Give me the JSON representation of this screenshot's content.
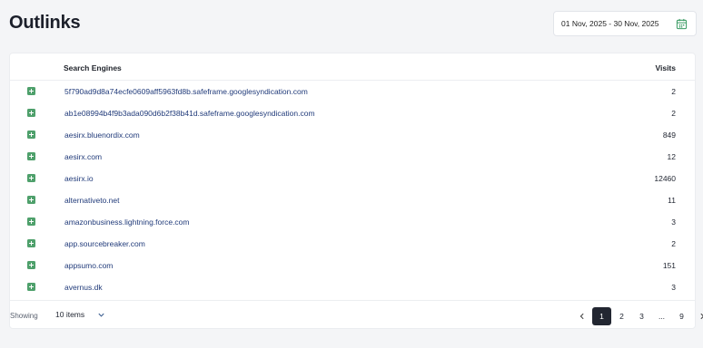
{
  "page": {
    "title": "Outlinks"
  },
  "date_range": {
    "label": "01 Nov, 2025 - 30 Nov, 2025",
    "icon": "calendar-icon",
    "icon_color": "#3a9b63"
  },
  "table": {
    "columns": {
      "engine": "Search Engines",
      "visits": "Visits"
    },
    "rows": [
      {
        "domain": "5f790ad9d8a74ecfe0609aff5963fd8b.safeframe.googlesyndication.com",
        "visits": "2"
      },
      {
        "domain": "ab1e08994b4f9b3ada090d6b2f38b41d.safeframe.googlesyndication.com",
        "visits": "2"
      },
      {
        "domain": "aesirx.bluenordix.com",
        "visits": "849"
      },
      {
        "domain": "aesirx.com",
        "visits": "12"
      },
      {
        "domain": "aesirx.io",
        "visits": "12460"
      },
      {
        "domain": "alternativeto.net",
        "visits": "11"
      },
      {
        "domain": "amazonbusiness.lightning.force.com",
        "visits": "3"
      },
      {
        "domain": "app.sourcebreaker.com",
        "visits": "2"
      },
      {
        "domain": "appsumo.com",
        "visits": "151"
      },
      {
        "domain": "avernus.dk",
        "visits": "3"
      }
    ],
    "expand_icon_color": "#4ea06b",
    "link_color": "#213b7a"
  },
  "footer": {
    "showing_label": "Showing",
    "per_page": "10 items",
    "pages": [
      "1",
      "2",
      "3",
      "...",
      "9"
    ],
    "active_page": "1"
  }
}
